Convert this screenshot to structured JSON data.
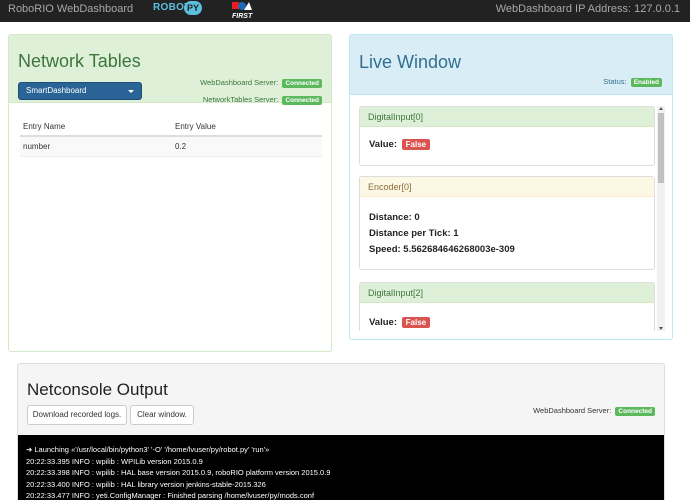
{
  "navbar": {
    "brand": "RoboRIO WebDashboard",
    "robotpy_logo_text": "ROBOT",
    "robotpy_logo_py": "PY",
    "first_logo_text": "FIRST",
    "ip_text": "WebDashboard IP Address: 127.0.0.1"
  },
  "network_tables": {
    "title": "Network Tables",
    "dropdown_label": "SmartDashboard",
    "webdashboard_server_label": "WebDashboard Server:",
    "webdashboard_server_status": "Connected",
    "networktables_server_label": "NetworkTables Server:",
    "networktables_server_status": "Connected",
    "columns": [
      "Entry Name",
      "Entry Value"
    ],
    "rows": [
      {
        "name": "number",
        "value": "0.2"
      }
    ]
  },
  "live_window": {
    "title": "Live Window",
    "status_label": "Status:",
    "status_value": "Enabled",
    "widgets": [
      {
        "title": "DigitalInput[0]",
        "value_label": "Value:",
        "value": "False"
      },
      {
        "title": "Encoder[0]",
        "distance": "Distance: 0",
        "distance_per_tick": "Distance per Tick: 1",
        "speed": "Speed: 5.562684646268003e-309"
      },
      {
        "title": "DigitalInput[2]",
        "value_label": "Value:",
        "value": "False"
      }
    ]
  },
  "netconsole": {
    "title": "Netconsole Output",
    "download_button": "Download recorded logs.",
    "clear_button": "Clear window.",
    "server_label": "WebDashboard Server:",
    "server_status": "Connected",
    "lines": [
      "➜ Launching «'/usr/local/bin/python3' '-O' '/home/lvuser/py/robot.py' 'run'»",
      "20:22:33.395 INFO : wpilib : WPILib version 2015.0.9",
      "20:22:33.398 INFO : wpilib : HAL base version 2015.0.9, roboRIO platform version 2015.0.9",
      "20:22:33.400 INFO : wpilib : HAL library version jenkins-stable-2015.326",
      "20:22:33.477 INFO : yeti.ConfigManager : Finished parsing /home/lvuser/py/mods.conf"
    ]
  },
  "colors": {
    "navbar_bg": "#222222",
    "success": "#5cb85c",
    "danger": "#d9534f",
    "primary": "#2a6496"
  }
}
